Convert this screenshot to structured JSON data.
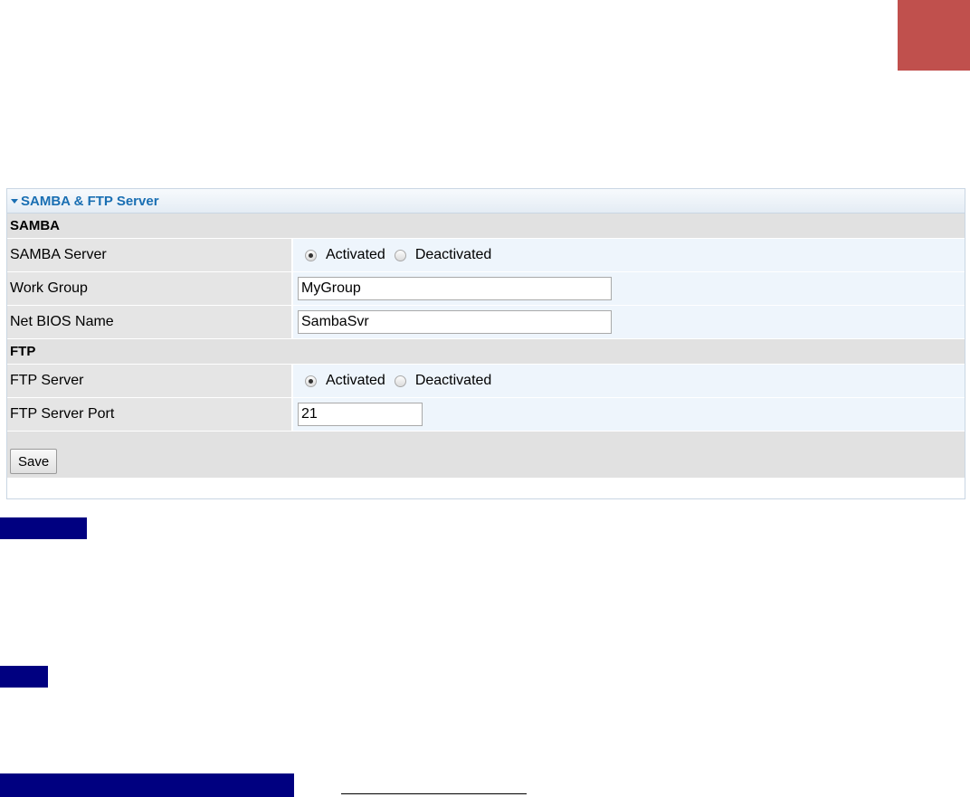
{
  "panel": {
    "title": "SAMBA & FTP Server"
  },
  "samba": {
    "section_label": "SAMBA",
    "server_label": "SAMBA Server",
    "server_options": [
      "Activated",
      "Deactivated"
    ],
    "server_selected": "Activated",
    "workgroup_label": "Work Group",
    "workgroup_value": "MyGroup",
    "netbios_label": "Net BIOS Name",
    "netbios_value": "SambaSvr"
  },
  "ftp": {
    "section_label": "FTP",
    "server_label": "FTP Server",
    "server_options": [
      "Activated",
      "Deactivated"
    ],
    "server_selected": "Activated",
    "port_label": "FTP Server Port",
    "port_value": "21"
  },
  "actions": {
    "save_label": "Save"
  },
  "colors": {
    "corner_block": "#c0504d",
    "highlight_bar": "#000080",
    "title_blue": "#1a6fb3"
  }
}
